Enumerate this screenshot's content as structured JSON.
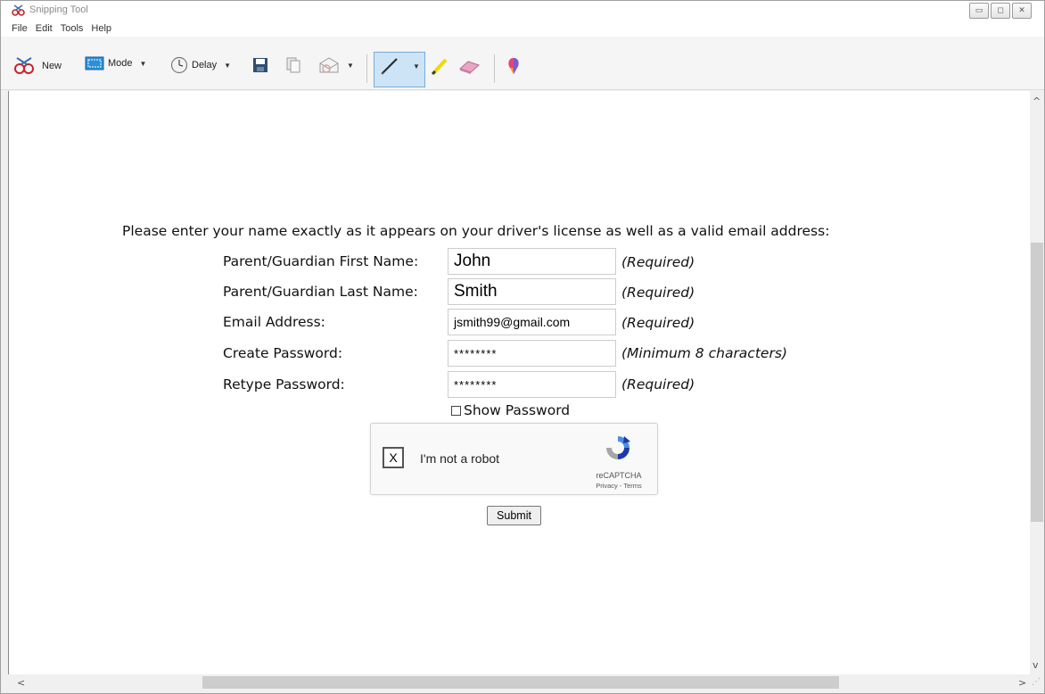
{
  "window": {
    "title": "Snipping Tool",
    "controls": {
      "minimize": "▭",
      "maximize": "◻",
      "close": "✕"
    }
  },
  "menu": [
    "File",
    "Edit",
    "Tools",
    "Help"
  ],
  "toolbar": {
    "new_label": "New",
    "mode_label": "Mode",
    "delay_label": "Delay",
    "dropdown_glyph": "▼"
  },
  "page": {
    "intro": "Please enter your name exactly as it appears on your driver's license as well as a valid email address:",
    "fields": [
      {
        "label": "Parent/Guardian First Name:",
        "value": "John",
        "note": "(Required)"
      },
      {
        "label": "Parent/Guardian Last Name:",
        "value": "Smith",
        "note": "(Required)"
      },
      {
        "label": "Email Address:",
        "value": "jsmith99@gmail.com",
        "note": "(Required)"
      },
      {
        "label": "Create Password:",
        "value": "********",
        "note": "(Minimum 8 characters)"
      },
      {
        "label": "Retype Password:",
        "value": "********",
        "note": "(Required)"
      }
    ],
    "show_password_label": "Show Password",
    "show_password_checked": false,
    "recaptcha": {
      "check_mark": "X",
      "label": "I'm not a robot",
      "brand": "reCAPTCHA",
      "links": "Privacy - Terms"
    },
    "submit_label": "Submit"
  },
  "scrollbars": {
    "up": "^",
    "down": "v",
    "left": "<",
    "right": ">"
  },
  "colors": {
    "pen_group_bg": "#cde4f7",
    "recaptcha_blue": "#1c3aa9",
    "recaptcha_light": "#4a90e2"
  }
}
